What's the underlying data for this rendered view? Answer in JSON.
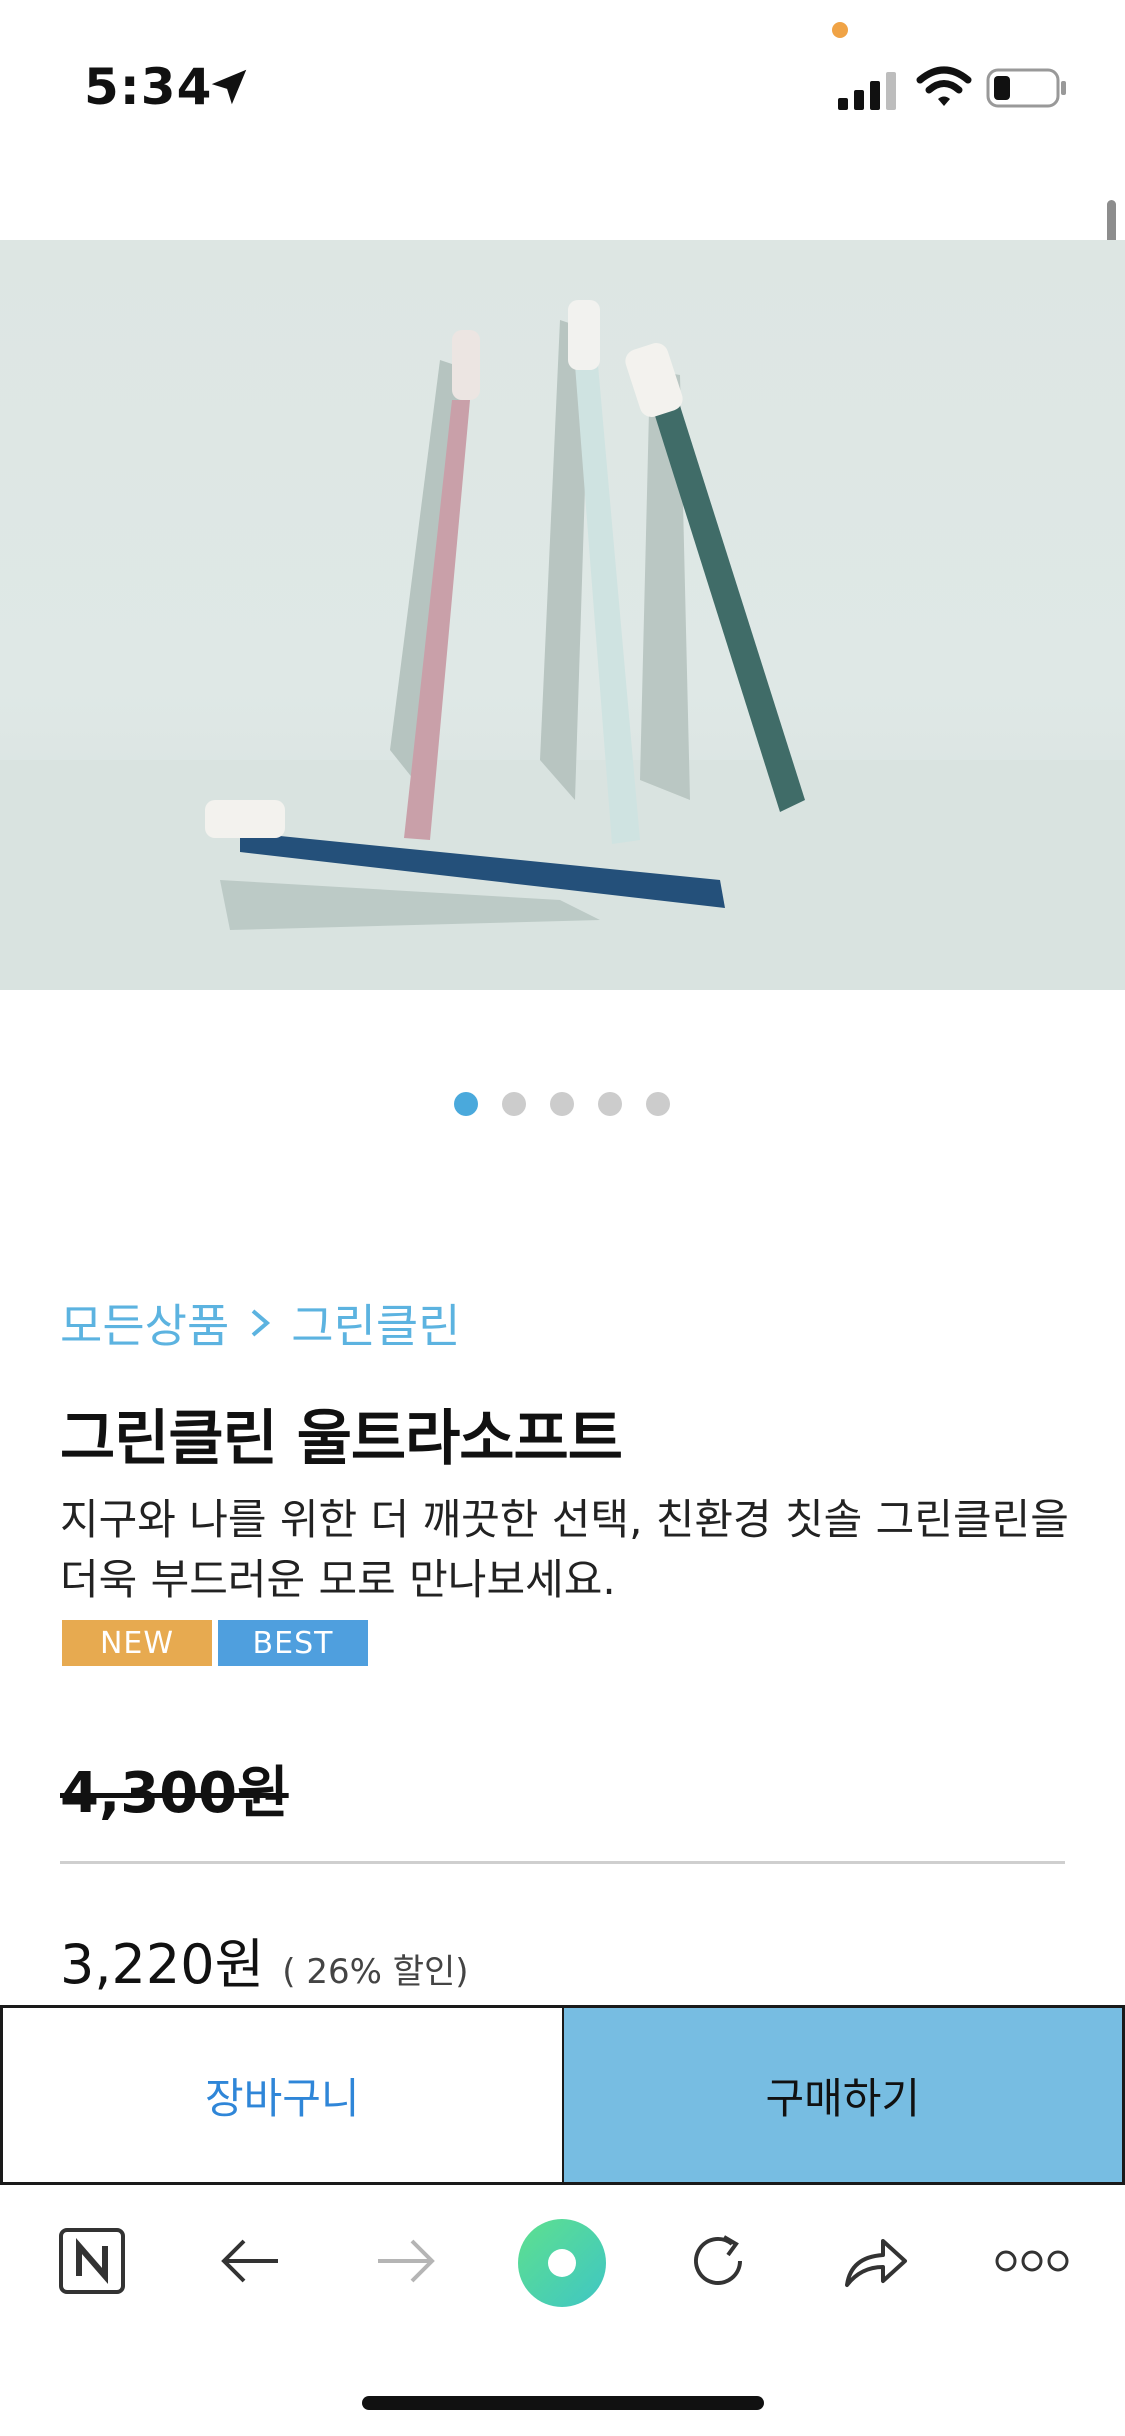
{
  "status_bar": {
    "time": "5:34"
  },
  "breadcrumb": {
    "root": "모든상품",
    "current": "그린클린"
  },
  "product": {
    "title": "그린클린 울트라소프트",
    "description": "지구와 나를 위한 더 깨끗한 선택, 친환경 칫솔 그린클린을 더욱 부드러운 모로 만나보세요.",
    "badges": [
      {
        "label": "NEW",
        "color": "#e7aa50"
      },
      {
        "label": "BEST",
        "color": "#4f9fde"
      }
    ],
    "original_price": "4,300원",
    "sale_price": "3,220원",
    "discount_note": "( 26% 할인)"
  },
  "carousel": {
    "total": 5,
    "active_index": 0
  },
  "actions": {
    "cart_label": "장바구니",
    "buy_label": "구매하기"
  },
  "colors": {
    "accent": "#4aa9dc",
    "breadcrumb": "#5cb3e0",
    "buy_button": "#77bde2",
    "cart_text": "#2f86d8",
    "recording_dot": "#f0a346"
  },
  "toolbar": {
    "icons": [
      "naver-home-icon",
      "back-arrow-icon",
      "forward-arrow-icon",
      "green-dot-icon",
      "refresh-icon",
      "share-icon",
      "more-icon"
    ]
  }
}
